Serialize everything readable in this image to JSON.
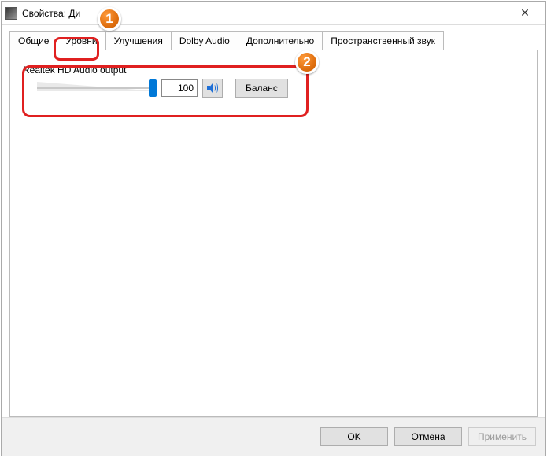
{
  "title": "Свойства: Ди",
  "tabs": [
    "Общие",
    "Уровни",
    "Улучшения",
    "Dolby Audio",
    "Дополнительно",
    "Пространственный звук"
  ],
  "active_tab_index": 1,
  "device": {
    "name": "Realtek HD Audio output",
    "level": 100,
    "level_percent": 100
  },
  "buttons": {
    "balance": "Баланс",
    "ok": "OK",
    "cancel": "Отмена",
    "apply": "Применить"
  },
  "annotations": {
    "badge1": "1",
    "badge2": "2"
  }
}
